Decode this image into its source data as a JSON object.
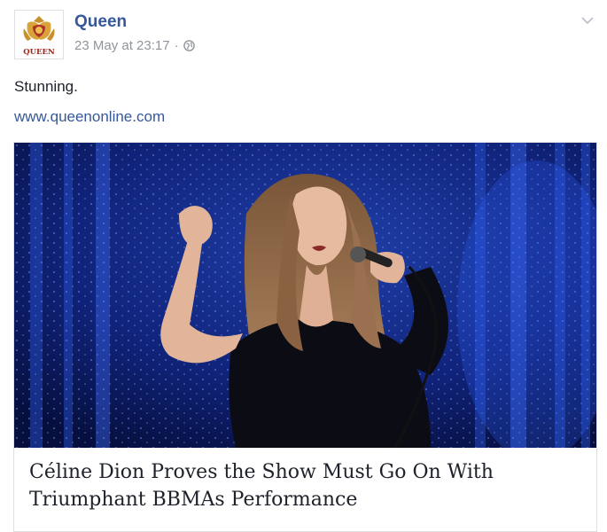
{
  "post": {
    "page_name": "Queen",
    "logo_text": "QUEEN",
    "timestamp": "23 May at 23:17",
    "separator": "·",
    "privacy_icon": "globe-icon",
    "menu_icon": "chevron-down-icon",
    "text": "Stunning.",
    "link": "www.queenonline.com"
  },
  "attachment": {
    "title": "Céline Dion Proves the Show Must Go On With Triumphant BBMAs Performance"
  },
  "colors": {
    "link_blue": "#365899",
    "meta_gray": "#90949c",
    "text": "#1d2129",
    "border": "#dddfe2"
  }
}
